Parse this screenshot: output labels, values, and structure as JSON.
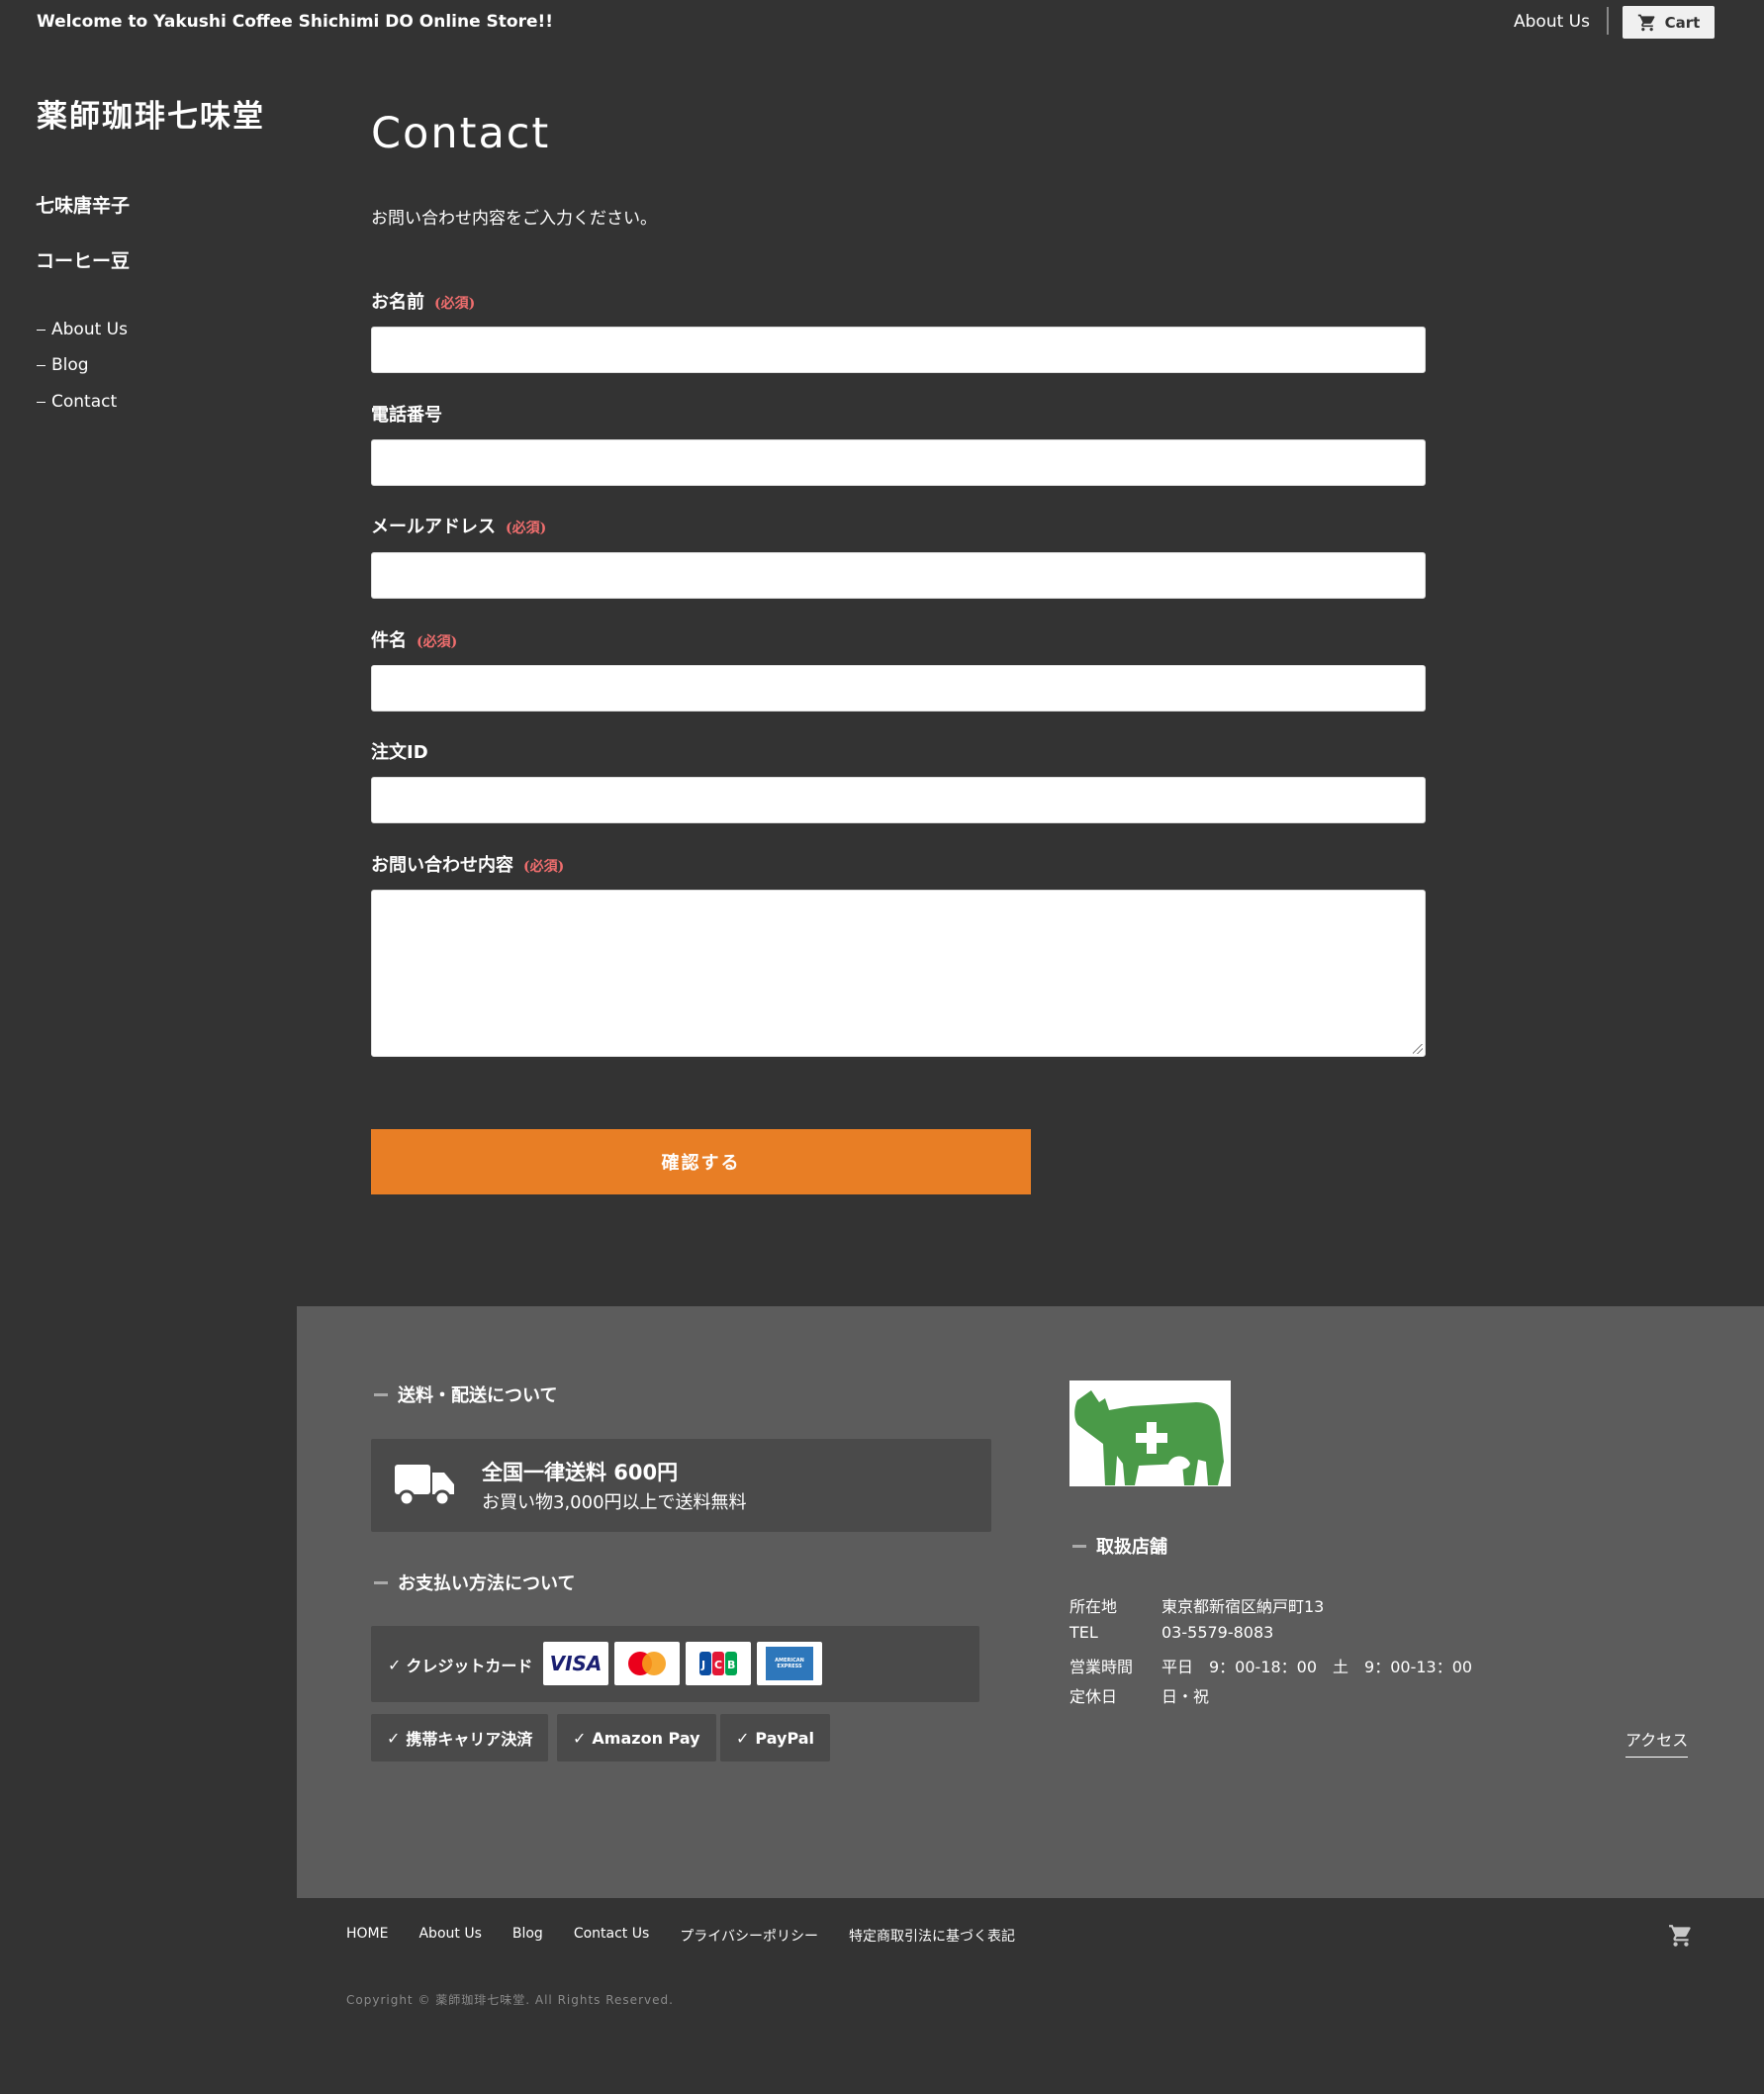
{
  "header": {
    "welcome": "Welcome to Yakushi Coffee Shichimi DO Online Store!!",
    "about_label": "About Us",
    "cart_label": "Cart"
  },
  "sidebar": {
    "logo": "薬師珈琲七味堂",
    "categories": [
      "七味唐辛子",
      "コーヒー豆"
    ],
    "links": [
      "About Us",
      "Blog",
      "Contact"
    ]
  },
  "form": {
    "title": "Contact",
    "intro": "お問い合わせ内容をご入力ください。",
    "required_label": "(必須)",
    "fields": [
      {
        "label": "お名前",
        "required": true
      },
      {
        "label": "電話番号",
        "required": false
      },
      {
        "label": "メールアドレス",
        "required": true
      },
      {
        "label": "件名",
        "required": true
      },
      {
        "label": "注文ID",
        "required": false
      },
      {
        "label": "お問い合わせ内容",
        "required": true
      }
    ],
    "submit_label": "確認する"
  },
  "footer": {
    "shipping": {
      "heading": "送料・配送について",
      "main": "全国一律送料 600円",
      "sub": "お買い物3,000円以上で送料無料"
    },
    "payment": {
      "heading": "お支払い方法について",
      "credit_label": "クレジットカード",
      "cards": [
        "VISA",
        "Mastercard",
        "JCB",
        "AMERICAN EXPRESS"
      ],
      "methods": [
        "携帯キャリア決済",
        "Amazon Pay",
        "PayPal"
      ]
    },
    "store": {
      "heading": "取扱店舗",
      "rows": [
        {
          "k": "所在地",
          "v": "東京都新宿区納戸町13"
        },
        {
          "k": "TEL",
          "v": "03-5579-8083"
        },
        {
          "k": "営業時間",
          "v": "平日　9：00-18：00　土　9：00-13：00"
        },
        {
          "k": "定休日",
          "v": "日・祝"
        }
      ],
      "access_label": "アクセス"
    },
    "nav": [
      "HOME",
      "About Us",
      "Blog",
      "Contact Us",
      "プライバシーポリシー",
      "特定商取引法に基づく表記"
    ],
    "copyright": "Copyright © 薬師珈琲七味堂. All Rights Reserved."
  },
  "colors": {
    "page_bg": "#333333",
    "footer_bg": "#5c5c5c",
    "accent": "#e87e25",
    "required": "#f06e6e",
    "cow_green": "#4a9a48"
  }
}
